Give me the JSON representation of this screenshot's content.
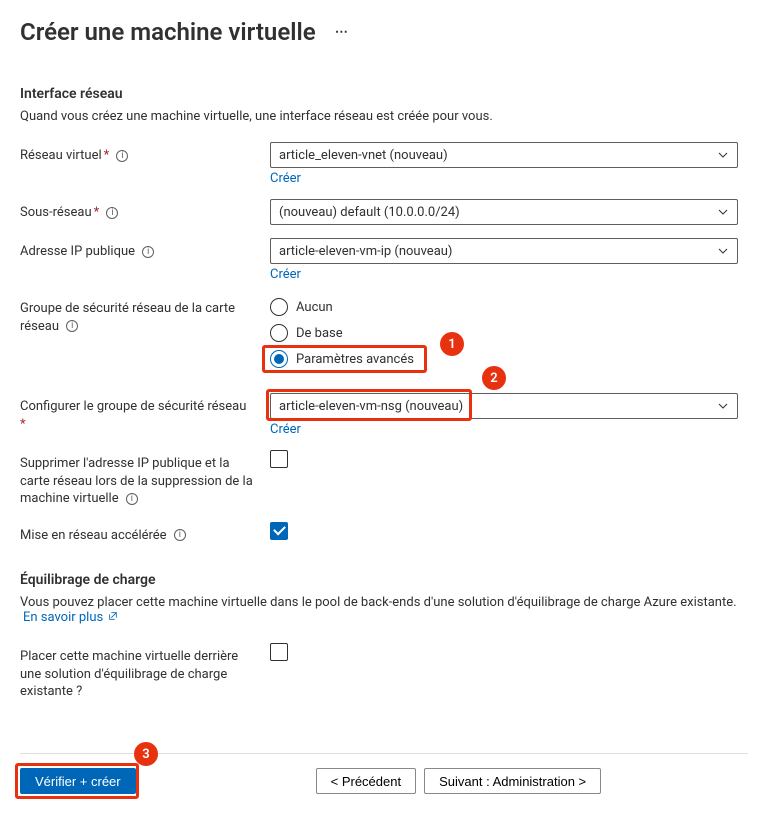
{
  "page_title": "Créer une machine virtuelle",
  "sections": {
    "interface_reseau": {
      "title": "Interface réseau",
      "desc": "Quand vous créez une machine virtuelle, une interface réseau est créée pour vous."
    },
    "equilibrage": {
      "title": "Équilibrage de charge",
      "desc": "Vous pouvez placer cette machine virtuelle dans le pool de back-ends d'une solution d'équilibrage de charge Azure existante.",
      "learn_more": "En savoir plus"
    }
  },
  "labels": {
    "reseau_virtuel": "Réseau virtuel",
    "sous_reseau": "Sous-réseau",
    "ip_publique": "Adresse IP publique",
    "nsg_carte": "Groupe de sécurité réseau de la carte réseau",
    "config_nsg": "Configurer le groupe de sécurité réseau",
    "suppr_ip": "Supprimer l'adresse IP publique et la carte réseau lors de la suppression de la machine virtuelle",
    "reseau_accelere": "Mise en réseau accélérée",
    "placer_vm": "Placer cette machine virtuelle derrière une solution d'équilibrage de charge existante ?"
  },
  "values": {
    "reseau_virtuel": "article_eleven-vnet (nouveau)",
    "sous_reseau": "(nouveau) default (10.0.0.0/24)",
    "ip_publique": "article-eleven-vm-ip (nouveau)",
    "config_nsg": "article-eleven-vm-nsg (nouveau)"
  },
  "actions": {
    "creer": "Créer"
  },
  "radio": {
    "aucun": "Aucun",
    "de_base": "De base",
    "avance": "Paramètres avancés"
  },
  "footer": {
    "verify": "Vérifier + créer",
    "prev": "< Précédent",
    "next": "Suivant : Administration >"
  },
  "callouts": {
    "c1": "1",
    "c2": "2",
    "c3": "3"
  }
}
